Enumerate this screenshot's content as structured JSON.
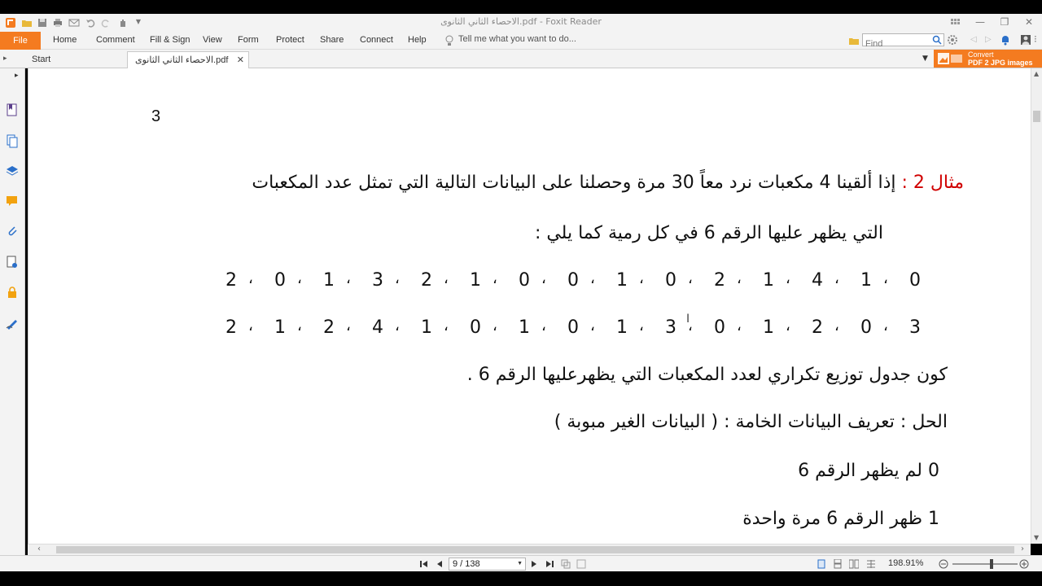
{
  "window": {
    "title": "الاحصاء الثاني الثانوى.pdf - Foxit Reader"
  },
  "ribbon": {
    "file": "File",
    "menus": [
      "Home",
      "Comment",
      "Fill & Sign",
      "View",
      "Form",
      "Protect",
      "Share",
      "Connect",
      "Help"
    ],
    "tell_me": "Tell me what you want to do...",
    "find_placeholder": "Find"
  },
  "tabs": {
    "start": "Start",
    "document": "الاحصاء الثاني الثانوى.pdf"
  },
  "convert_banner": {
    "line1": "Convert",
    "line2": "PDF 2 JPG images"
  },
  "document": {
    "page_number": "3",
    "example_label": "مثال 2 :",
    "line1": " إذا ألقينا 4 مكعبات نرد معاً 30 مرة وحصلنا على البيانات التالية التي تمثل عدد المكعبات",
    "line2": "التي يظهر عليها الرقم 6 في كل رمية كما يلي :",
    "data_row1": [
      "0",
      "1",
      "4",
      "1",
      "2",
      "0",
      "1",
      "0",
      "0",
      "1",
      "2",
      "3",
      "1",
      "0",
      "2"
    ],
    "data_row2": [
      "3",
      "0",
      "2",
      "1",
      "0",
      "3",
      "1",
      "0",
      "1",
      "0",
      "1",
      "4",
      "2",
      "1",
      "2"
    ],
    "separator": "،",
    "line3": "كون جدول توزيع تكراري لعدد المكعبات التي يظهرعليها الرقم 6 .",
    "line4": "الحل :  تعريف البيانات الخامة :  ( البيانات الغير مبوبة )",
    "line5": "0  لم يظهر الرقم 6",
    "line6": "1  ظهر الرقم 6 مرة واحدة"
  },
  "status": {
    "page_indicator": "9 / 138",
    "zoom": "198.91%"
  },
  "colors": {
    "accent": "#f47b20",
    "example_label": "#d00000"
  }
}
